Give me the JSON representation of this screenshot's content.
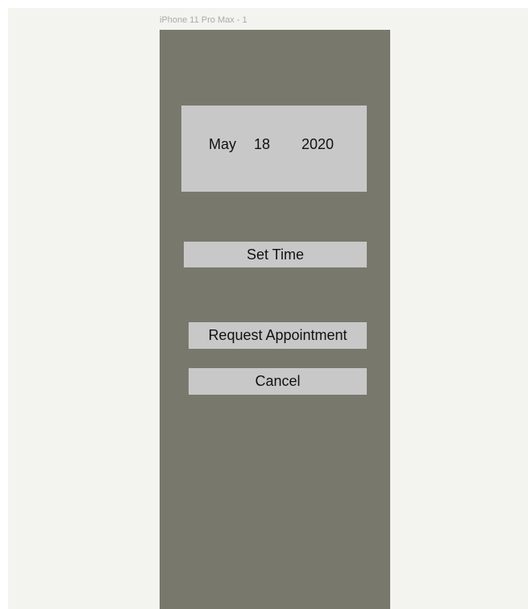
{
  "canvas": {
    "frame_label": "iPhone 11 Pro Max - 1"
  },
  "date_picker": {
    "month": "May",
    "day": "18",
    "year": "2020"
  },
  "actions": {
    "set_time_label": "Set Time",
    "request_label": "Request Appointment",
    "cancel_label": "Cancel"
  },
  "colors": {
    "canvas_bg": "#f3f3ef",
    "phone_bg": "#78786c",
    "control_bg": "#c8c8c8",
    "text": "#111111",
    "frame_label": "#aaaaaa"
  }
}
